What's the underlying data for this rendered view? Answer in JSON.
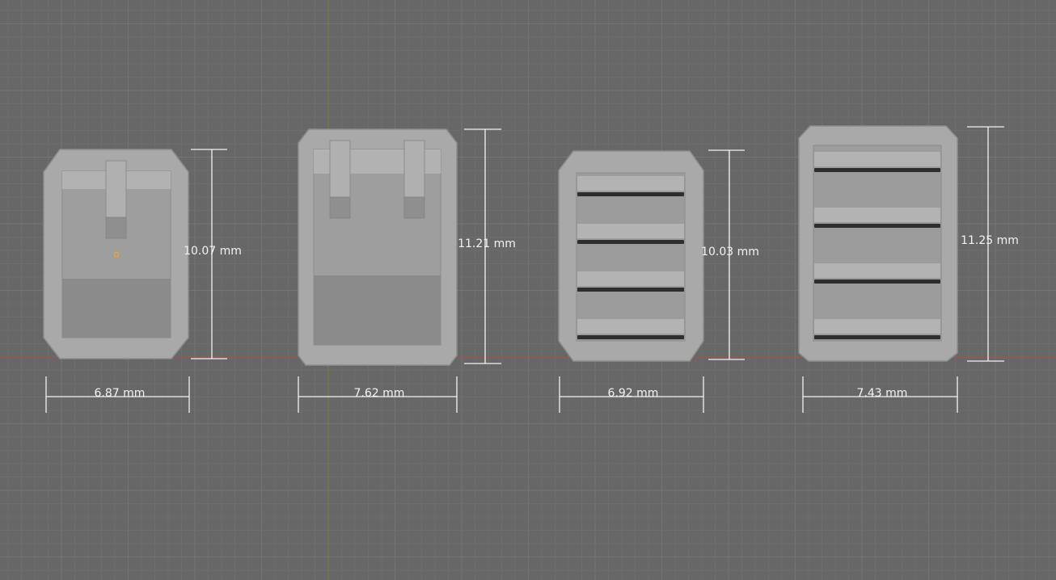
{
  "viewport": {
    "background": "#676767",
    "grid_minor_color": "#6e6e6e",
    "grid_major_color": "#747474",
    "x_axis_color": "#b34d4d",
    "y_axis_color": "#6b8a3a"
  },
  "objects": [
    {
      "name": "part-a",
      "type": "connector-housing",
      "width_label": "6.87 mm",
      "height_label": "10.07 mm",
      "selected": true
    },
    {
      "name": "part-b",
      "type": "connector-housing",
      "width_label": "7.62 mm",
      "height_label": "11.21 mm",
      "selected": false
    },
    {
      "name": "part-c",
      "type": "slotted-housing",
      "width_label": "6.92 mm",
      "height_label": "10.03 mm",
      "selected": false
    },
    {
      "name": "part-d",
      "type": "slotted-housing",
      "width_label": "7.43 mm",
      "height_label": "11.25 mm",
      "selected": false
    }
  ],
  "colors": {
    "body": "#a9a9a9",
    "body_edge": "#8e8e8e",
    "inset": "#9c9c9c",
    "inset_light": "#b0b0b0",
    "inset_dark": "#8a8a8a",
    "slat": "#b3b3b3",
    "slot": "#2e2e2e",
    "dimension_line": "#f2f2f2",
    "origin": "#e8a33a"
  }
}
